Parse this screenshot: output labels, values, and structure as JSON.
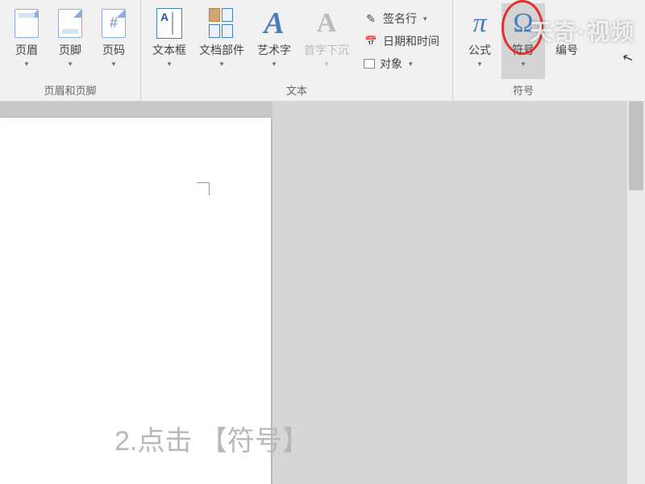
{
  "ribbon": {
    "groups": {
      "header_footer": {
        "label": "页眉和页脚",
        "header": "页眉",
        "footer": "页脚",
        "page_number": "页码"
      },
      "text": {
        "label": "文本",
        "textbox": "文本框",
        "doc_parts": "文档部件",
        "wordart": "艺术字",
        "dropcap": "首字下沉",
        "signature": "签名行",
        "datetime": "日期和时间",
        "object": "对象"
      },
      "symbols": {
        "label": "符号",
        "equation": "公式",
        "symbol": "符号",
        "number": "编号"
      }
    }
  },
  "watermark": "天奇·视频",
  "instruction": "2.点击 【符号】",
  "icons": {
    "pen": "✎",
    "calendar": "📅",
    "object": "▭",
    "pi": "π",
    "omega": "Ω"
  }
}
